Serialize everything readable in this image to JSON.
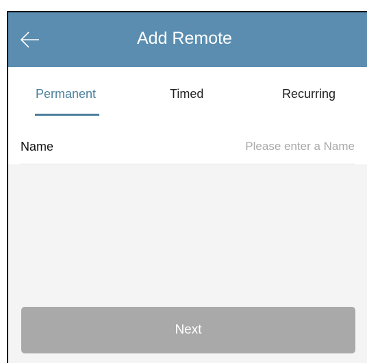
{
  "header": {
    "title": "Add Remote",
    "back_icon": "arrow-left-icon",
    "color": "#5a8db0"
  },
  "tabs": [
    {
      "label": "Permanent",
      "active": true
    },
    {
      "label": "Timed",
      "active": false
    },
    {
      "label": "Recurring",
      "active": false
    }
  ],
  "accent_color": "#4a7f9c",
  "form": {
    "name_label": "Name",
    "name_value": "",
    "name_placeholder": "Please enter a Name"
  },
  "footer": {
    "next_label": "Next",
    "next_enabled": false
  }
}
